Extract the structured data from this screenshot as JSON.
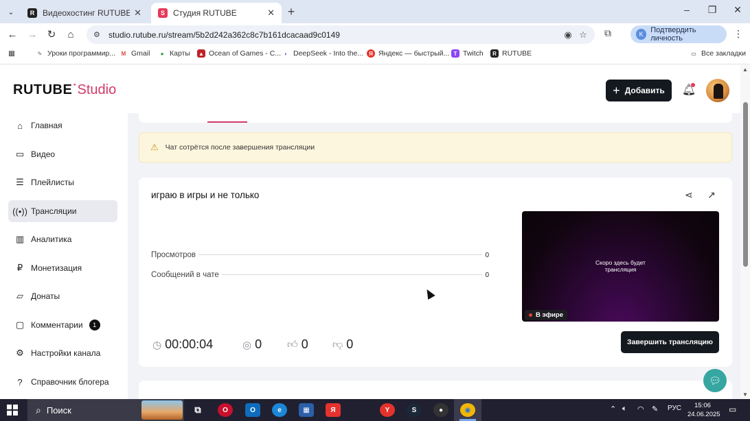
{
  "browser": {
    "tabs": [
      {
        "title": "Видеохостинг RUTUBE. Смотр",
        "active": false
      },
      {
        "title": "Студия RUTUBE",
        "active": true
      }
    ],
    "url": "studio.rutube.ru/stream/5b2d242a362c8c7b161dcacaad9c0149",
    "verify_label": "Подтвердить личность",
    "bookmarks": [
      {
        "label": "Уроки программир...",
        "icon": "youtube-icon"
      },
      {
        "label": "Gmail",
        "icon": "gmail-icon"
      },
      {
        "label": "Карты",
        "icon": "maps-icon"
      },
      {
        "label": "Ocean of Games - C...",
        "icon": "game-icon"
      },
      {
        "label": "DeepSeek - Into the...",
        "icon": "deepseek-icon"
      },
      {
        "label": "Яндекс — быстрый...",
        "icon": "yandex-icon"
      },
      {
        "label": "Twitch",
        "icon": "twitch-icon"
      },
      {
        "label": "RUTUBE",
        "icon": "rutube-icon"
      }
    ],
    "all_bookmarks_label": "Все закладки"
  },
  "header": {
    "logo_main": "RUTUBE",
    "logo_studio": "Studio",
    "add_label": "Добавить"
  },
  "sidebar": {
    "items": [
      {
        "label": "Главная",
        "icon": "home-icon"
      },
      {
        "label": "Видео",
        "icon": "video-icon"
      },
      {
        "label": "Плейлисты",
        "icon": "playlist-icon"
      },
      {
        "label": "Трансляции",
        "icon": "broadcast-icon",
        "active": true
      },
      {
        "label": "Аналитика",
        "icon": "analytics-icon"
      },
      {
        "label": "Монетизация",
        "icon": "monetization-icon"
      },
      {
        "label": "Донаты",
        "icon": "donate-icon"
      },
      {
        "label": "Комментарии",
        "icon": "comments-icon",
        "badge": "1"
      },
      {
        "label": "Настройки канала",
        "icon": "settings-icon"
      },
      {
        "label": "Справочник блогера",
        "icon": "guide-icon"
      }
    ]
  },
  "warning": {
    "text": "Чат сотрётся после завершения трансляции"
  },
  "stream": {
    "title": "играю в игры и не только",
    "stats": [
      {
        "label": "Просмотров",
        "value": "0"
      },
      {
        "label": "Сообщений в чате",
        "value": "0"
      }
    ],
    "preview_text_line1": "Скоро здесь будет",
    "preview_text_line2": "трансляция",
    "live_label": "В эфире",
    "duration": "00:00:04",
    "viewers": "0",
    "likes": "0",
    "dislikes": "0",
    "end_label": "Завершить трансляцию"
  },
  "taskbar": {
    "search_label": "Поиск",
    "lang": "РУС",
    "time": "15:06",
    "date": "24.06.2025"
  },
  "colors": {
    "accent": "#d23a68",
    "dark_button": "#14191f",
    "warning_bg": "#fdf6de",
    "chat_fab": "#36a6a1"
  }
}
